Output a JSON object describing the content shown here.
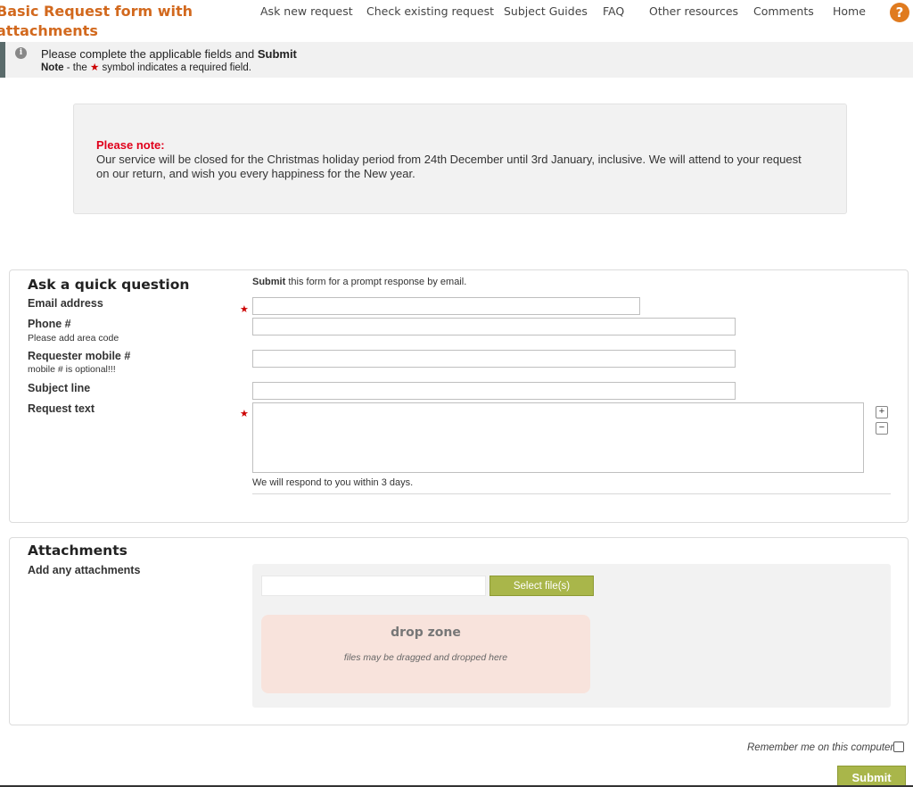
{
  "header": {
    "title": "Basic Request form with attachments",
    "nav": [
      "Ask new request",
      "Check existing request",
      "Subject Guides",
      "FAQ",
      "Other resources",
      "Comments",
      "Home"
    ],
    "help_label": "?"
  },
  "infobar": {
    "line1_prefix": "Please complete the applicable fields and ",
    "line1_bold": "Submit",
    "note_label": "Note",
    "line2_prefix": " - the ",
    "star": "★",
    "line2_suffix": " symbol indicates a required field."
  },
  "notice": {
    "title": "Please note:",
    "body": "Our service will be closed for the Christmas holiday period from 24th December until 3rd January, inclusive.  We will attend to your request on our return, and wish you every happiness for the New year."
  },
  "question": {
    "title": "Ask a quick question",
    "intro_bold": "Submit",
    "intro_rest": " this form for a prompt response by email.",
    "email_label": "Email address",
    "phone_label": "Phone #",
    "phone_hint": "Please add area code",
    "mobile_label": "Requester mobile #",
    "mobile_hint": "mobile # is optional!!!",
    "subject_label": "Subject line",
    "request_label": "Request text",
    "required_star": "★",
    "respond_note": "We will respond to you within 3 days.",
    "plus": "+",
    "minus": "−"
  },
  "attachments": {
    "title": "Attachments",
    "label": "Add any attachments",
    "select_button": "Select file(s)",
    "dropzone_title": "drop zone",
    "dropzone_hint": "files may be dragged and dropped here"
  },
  "footer": {
    "remember_label": "Remember me on this computer",
    "submit_label": "Submit"
  },
  "colors": {
    "brand": "#d2691e",
    "accent_button": "#a9b64a",
    "required": "#cc0000",
    "notice_title": "#e0001b",
    "dropzone": "#f8e3dc"
  },
  "icons": {
    "help": "help-circle-icon",
    "info": "info-circle-icon",
    "plus": "plus-icon",
    "minus": "minus-icon"
  }
}
